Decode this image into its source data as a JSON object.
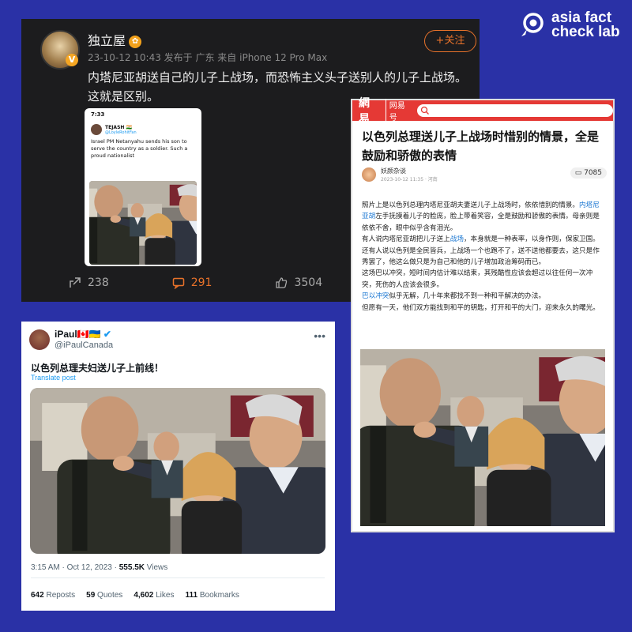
{
  "logo": {
    "line1": "asia fact",
    "line2": "check lab"
  },
  "weibo": {
    "username": "独立屋",
    "user_badge": "✿",
    "verified_badge": "V",
    "meta": "23-10-12 10:43 发布于 广东 来自 iPhone 12 Pro Max",
    "follow_label": "+关注",
    "body": "内塔尼亚胡送自己的儿子上战场，而恐怖主义头子送别人的儿子上战场。这就是区别。",
    "embed": {
      "status_time": "7:33",
      "user_name": "TEJASH 🇮🇳",
      "user_handle": "@LoyleRohitFan",
      "text": "Israel PM Netanyahu sends his son to serve the country as a soldier. Such a proud nationalist"
    },
    "share_count": "238",
    "comment_count": "291",
    "like_count": "3504"
  },
  "netease": {
    "brand": "網易",
    "brand_sub": "网易号",
    "title": "以色列总理送儿子上战场时惜别的情景，全是鼓励和骄傲的表情",
    "author": "妖颜杂谈",
    "date": "2023-10-12 11:35 · 河南",
    "comment_count": "7085",
    "p1a": "照片上是以色列总理内塔尼亚胡夫妻送儿子上战场时，依依惜别的情景。",
    "p1_link": "内塔尼亚胡",
    "p1b": "左手抚摸着儿子的脸庞，脸上带着笑容，全是鼓励和骄傲的表情。母亲则是依依不舍，眼中似乎含有泪光。",
    "p2a": "有人说内塔尼亚胡把儿子送上",
    "p2_link": "战场",
    "p2b": "，本身就是一种表率，以身作则，保家卫国。",
    "p3": "还有人说以色列是全民皆兵，上战场一个也跑不了，送不送他都要去，这只是作秀罢了，他这么做只是为自己和他的儿子增加政治筹码而已。",
    "p4": "这场巴以冲突，短时间内估计难以结束，其残酷性应该会超过以往任何一次冲突，死伤的人应该会很多。",
    "p5_link": "巴以冲突",
    "p5b": "似乎无解，几十年来都找不到一种和平解决的办法。",
    "p6": "但愿有一天，他们双方能找到和平的钥匙，打开和平的大门，迎来永久的曙光。"
  },
  "twitter": {
    "name": "iPaul🇨🇦🇺🇦",
    "verified_icon": "✔",
    "handle": "@iPaulCanada",
    "text": "以色列总理夫妇送儿子上前线！",
    "translate": "Translate post",
    "time": "3:15 AM · Oct 12, 2023 · ",
    "views": "555.5K",
    "views_label": " Views",
    "reposts": "642",
    "reposts_label": " Reposts",
    "quotes": "59",
    "quotes_label": " Quotes",
    "likes": "4,602",
    "likes_label": " Likes",
    "bookmarks": "111",
    "bookmarks_label": " Bookmarks"
  }
}
